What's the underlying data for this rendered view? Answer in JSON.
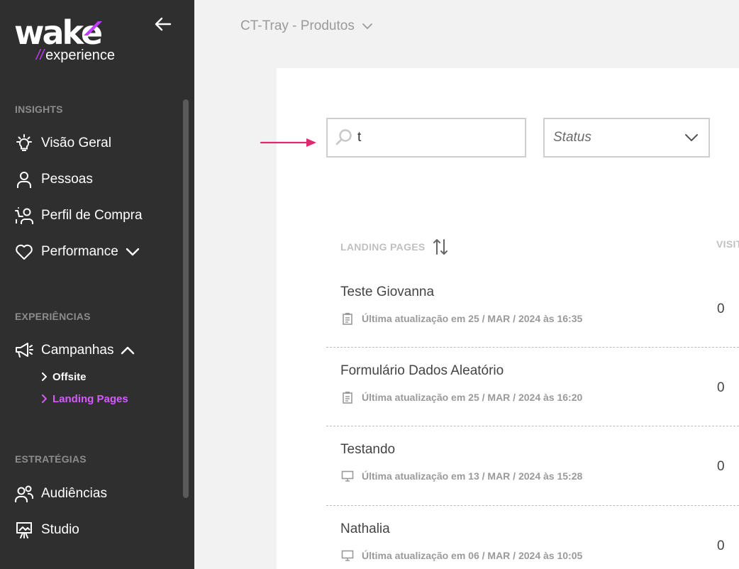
{
  "sidebar": {
    "logo_text": "wake",
    "logo_sub_slash": "//",
    "logo_sub_text": "experience",
    "sections": {
      "insights": "INSIGHTS",
      "experiencias": "EXPERIÊNCIAS",
      "estrategias": "ESTRATÉGIAS"
    },
    "items": {
      "visao_geral": "Visão Geral",
      "pessoas": "Pessoas",
      "perfil_compra": "Perfil de Compra",
      "performance": "Performance",
      "campanhas": "Campanhas",
      "offsite": "Offsite",
      "landing_pages": "Landing Pages",
      "audiencias": "Audiências",
      "studio": "Studio"
    },
    "accent_color": "#d45bff"
  },
  "header": {
    "project": "CT-Tray - Produtos"
  },
  "filters": {
    "search_value": "t",
    "status_label": "Status"
  },
  "table": {
    "col_landing_pages": "LANDING PAGES",
    "col_visits": "VISITAS",
    "rows": [
      {
        "title": "Teste Giovanna",
        "meta": "Última atualização em 25 / MAR / 2024 às 16:35",
        "icon": "clipboard-icon",
        "visits": "0"
      },
      {
        "title": "Formulário Dados Aleatório",
        "meta": "Última atualização em 25 / MAR / 2024 às 16:20",
        "icon": "clipboard-icon",
        "visits": "0"
      },
      {
        "title": "Testando",
        "meta": "Última atualização em 13 / MAR / 2024 às 15:28",
        "icon": "monitor-icon",
        "visits": "0"
      },
      {
        "title": "Nathalia",
        "meta": "Última atualização em 06 / MAR / 2024 às 10:05",
        "icon": "monitor-icon",
        "visits": "0"
      }
    ]
  }
}
